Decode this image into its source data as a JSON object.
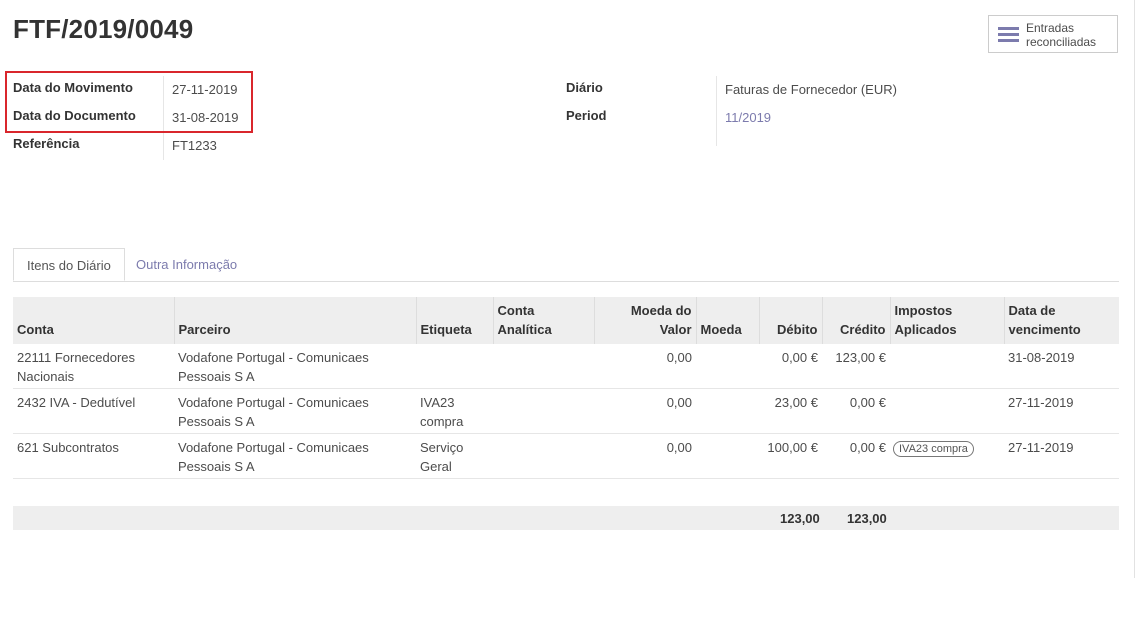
{
  "title": "FTF/2019/0049",
  "button_box": {
    "reconciled_label_line1": "Entradas",
    "reconciled_label_line2": "reconciliadas"
  },
  "left_fields": {
    "date_label": "Data do Movimento",
    "date_value": "27-11-2019",
    "doc_date_label": "Data do Documento",
    "doc_date_value": "31-08-2019",
    "ref_label": "Referência",
    "ref_value": "FT1233"
  },
  "right_fields": {
    "journal_label": "Diário",
    "journal_value": "Faturas de Fornecedor (EUR)",
    "period_label": "Period",
    "period_value": "11/2019"
  },
  "tabs": [
    {
      "label": "Itens do Diário"
    },
    {
      "label": "Outra Informação"
    }
  ],
  "table": {
    "headers": {
      "conta": "Conta",
      "parceiro": "Parceiro",
      "etiqueta": "Etiqueta",
      "analitica_1": "Conta",
      "analitica_2": "Analítica",
      "moeda_valor_1": "Moeda do",
      "moeda_valor_2": "Valor",
      "moeda": "Moeda",
      "debito": "Débito",
      "credito": "Crédito",
      "impostos_1": "Impostos",
      "impostos_2": "Aplicados",
      "venc_1": "Data de",
      "venc_2": "vencimento"
    },
    "rows": [
      {
        "conta_1": "22111 Fornecedores",
        "conta_2": "Nacionais",
        "parceiro_1": "Vodafone Portugal - Comunicaes",
        "parceiro_2": "Pessoais S A",
        "etiqueta_1": "",
        "etiqueta_2": "",
        "moeda_valor": "0,00",
        "debito": "0,00 €",
        "credito": "123,00 €",
        "impostos": "",
        "vencimento": "31-08-2019"
      },
      {
        "conta_1": "2432 IVA - Dedutível",
        "conta_2": "",
        "parceiro_1": "Vodafone Portugal - Comunicaes",
        "parceiro_2": "Pessoais S A",
        "etiqueta_1": "IVA23",
        "etiqueta_2": "compra",
        "moeda_valor": "0,00",
        "debito": "23,00 €",
        "credito": "0,00 €",
        "impostos": "",
        "vencimento": "27-11-2019"
      },
      {
        "conta_1": "621 Subcontratos",
        "conta_2": "",
        "parceiro_1": "Vodafone Portugal - Comunicaes",
        "parceiro_2": "Pessoais S A",
        "etiqueta_1": "Serviço",
        "etiqueta_2": "Geral",
        "moeda_valor": "0,00",
        "debito": "100,00 €",
        "credito": "0,00 €",
        "impostos": "IVA23 compra",
        "vencimento": "27-11-2019"
      }
    ],
    "totals": {
      "debito": "123,00",
      "credito": "123,00"
    }
  },
  "colors": {
    "link": "#7c7bad",
    "highlight": "#d9262c",
    "header_bg": "#eeeeee"
  }
}
